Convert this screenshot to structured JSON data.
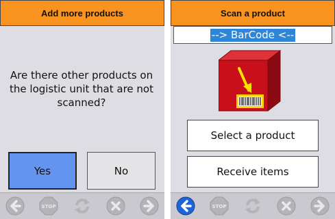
{
  "left_panel": {
    "header_title": "Add more products",
    "question": "Are there other products on the logistic unit that are not scanned?",
    "yes_label": "Yes",
    "no_label": "No",
    "stop_label": "STOP"
  },
  "right_panel": {
    "header_title": "Scan a product",
    "barcode_text": "--> BarCode <--",
    "select_product_label": "Select a product",
    "receive_items_label": "Receive items",
    "stop_label": "STOP"
  },
  "icons": [
    "back-arrow-icon",
    "stop-icon",
    "refresh-icon",
    "cancel-icon",
    "forward-arrow-icon"
  ],
  "colors": {
    "header": "#f7931e",
    "panel_bg": "#dedde4",
    "yes_button": "#6493f0",
    "barcode_highlight": "#2f86d6",
    "back_active": "#1f63d8",
    "box_red": "#c8101a"
  }
}
